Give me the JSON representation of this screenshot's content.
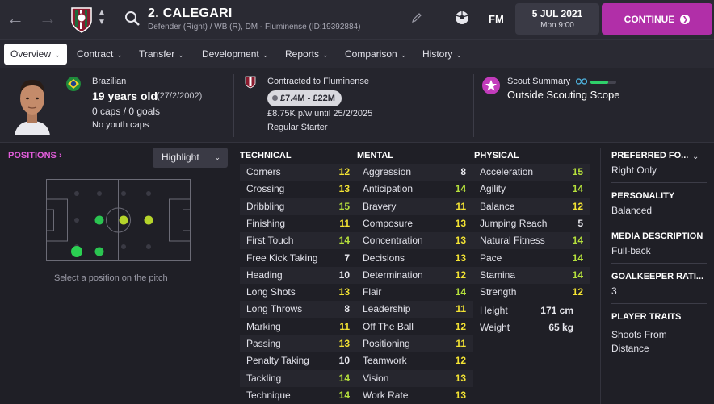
{
  "topbar": {
    "back_icon": "back-arrow-icon",
    "forward_icon": "forward-arrow-icon",
    "player_title": "2. CALEGARI",
    "player_subtitle": "Defender (Right) / WB (R), DM - Fluminense (ID:19392884)",
    "fm_label": "FM",
    "date": "5 JUL 2021",
    "time": "Mon 9:00",
    "continue_label": "CONTINUE"
  },
  "tabs": [
    {
      "label": "Overview",
      "active": true
    },
    {
      "label": "Contract"
    },
    {
      "label": "Transfer"
    },
    {
      "label": "Development"
    },
    {
      "label": "Reports"
    },
    {
      "label": "Comparison"
    },
    {
      "label": "History"
    }
  ],
  "info": {
    "nationality": "Brazilian",
    "age": "19 years old",
    "dob": "(27/2/2002)",
    "caps": "0 caps / 0 goals",
    "youth_caps": "No youth caps",
    "contract_label": "Contracted to Fluminense",
    "value_range": "£7.4M - £22M",
    "wage": "£8.75K p/w until 25/2/2025",
    "squad_status": "Regular Starter",
    "scout_title": "Scout Summary",
    "scout_status": "Outside Scouting Scope",
    "scout_knowledge": 0.7
  },
  "positions": {
    "title": "POSITIONS",
    "highlight_label": "Highlight",
    "hint": "Select a position on the pitch"
  },
  "columns": {
    "technical": "TECHNICAL",
    "mental": "MENTAL",
    "physical": "PHYSICAL"
  },
  "technical": [
    {
      "name": "Corners",
      "value": "12"
    },
    {
      "name": "Crossing",
      "value": "13"
    },
    {
      "name": "Dribbling",
      "value": "15"
    },
    {
      "name": "Finishing",
      "value": "11"
    },
    {
      "name": "First Touch",
      "value": "14"
    },
    {
      "name": "Free Kick Taking",
      "value": "7"
    },
    {
      "name": "Heading",
      "value": "10"
    },
    {
      "name": "Long Shots",
      "value": "13"
    },
    {
      "name": "Long Throws",
      "value": "8"
    },
    {
      "name": "Marking",
      "value": "11"
    },
    {
      "name": "Passing",
      "value": "13"
    },
    {
      "name": "Penalty Taking",
      "value": "10"
    },
    {
      "name": "Tackling",
      "value": "14"
    },
    {
      "name": "Technique",
      "value": "14"
    }
  ],
  "mental": [
    {
      "name": "Aggression",
      "value": "8"
    },
    {
      "name": "Anticipation",
      "value": "14"
    },
    {
      "name": "Bravery",
      "value": "11"
    },
    {
      "name": "Composure",
      "value": "13"
    },
    {
      "name": "Concentration",
      "value": "13"
    },
    {
      "name": "Decisions",
      "value": "13"
    },
    {
      "name": "Determination",
      "value": "12"
    },
    {
      "name": "Flair",
      "value": "14"
    },
    {
      "name": "Leadership",
      "value": "11"
    },
    {
      "name": "Off The Ball",
      "value": "12"
    },
    {
      "name": "Positioning",
      "value": "11"
    },
    {
      "name": "Teamwork",
      "value": "12"
    },
    {
      "name": "Vision",
      "value": "13"
    },
    {
      "name": "Work Rate",
      "value": "13"
    }
  ],
  "physical": [
    {
      "name": "Acceleration",
      "value": "15"
    },
    {
      "name": "Agility",
      "value": "14"
    },
    {
      "name": "Balance",
      "value": "12"
    },
    {
      "name": "Jumping Reach",
      "value": "5"
    },
    {
      "name": "Natural Fitness",
      "value": "14"
    },
    {
      "name": "Pace",
      "value": "14"
    },
    {
      "name": "Stamina",
      "value": "14"
    },
    {
      "name": "Strength",
      "value": "12"
    }
  ],
  "physical_extra": [
    {
      "name": "Height",
      "value": "171 cm"
    },
    {
      "name": "Weight",
      "value": "65 kg"
    }
  ],
  "side": {
    "preferred_foot_h": "PREFERRED FO...",
    "preferred_foot_v": "Right Only",
    "personality_h": "PERSONALITY",
    "personality_v": "Balanced",
    "media_h": "MEDIA DESCRIPTION",
    "media_v": "Full-back",
    "gk_h": "GOALKEEPER RATI...",
    "gk_v": "3",
    "traits_h": "PLAYER TRAITS",
    "traits_v": "Shoots From Distance"
  },
  "colors": {
    "accent": "#b12fa8",
    "value_high": "#b5e03c",
    "value_mid": "#f3e333",
    "value_low": "#e8e8ee"
  }
}
